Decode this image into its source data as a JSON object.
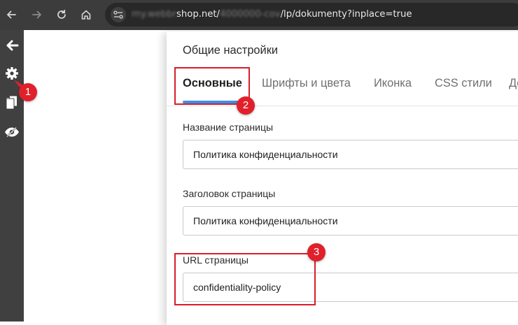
{
  "browser": {
    "url_parts": [
      "shop.net/",
      "/lp/dokumenty?inplace=true"
    ],
    "nav_icons": [
      "back-arrow-icon",
      "forward-arrow-icon",
      "reload-icon",
      "home-icon"
    ]
  },
  "leftbar": {
    "icons": [
      "exit-arrow-icon",
      "gear-icon",
      "pages-icon",
      "preview-eye-icon"
    ]
  },
  "panel": {
    "title": "Общие настройки",
    "tabs": [
      {
        "label": "Основные",
        "active": true
      },
      {
        "label": "Шрифты и цвета"
      },
      {
        "label": "Иконка"
      },
      {
        "label": "CSS стили"
      },
      {
        "label": "До"
      }
    ],
    "fields": {
      "page_name": {
        "label": "Название страницы",
        "value": "Политика конфиденциальности"
      },
      "page_heading": {
        "label": "Заголовок страницы",
        "value": "Политика конфиденциальности"
      },
      "page_url": {
        "label": "URL страницы",
        "value": "confidentiality-policy"
      }
    }
  },
  "annotations": {
    "color": "#e0202a",
    "badges": [
      "1",
      "2",
      "3"
    ]
  }
}
